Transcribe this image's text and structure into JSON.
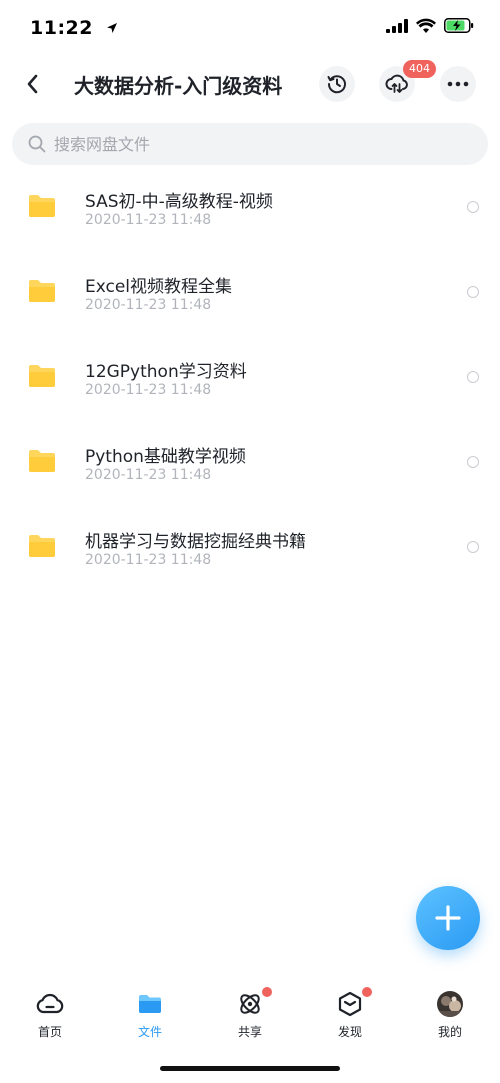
{
  "status": {
    "time": "11:22"
  },
  "header": {
    "title": "大数据分析-入门级资料",
    "transfer_badge": "404"
  },
  "search": {
    "placeholder": "搜索网盘文件"
  },
  "files": [
    {
      "name": "SAS初-中-高级教程-视频",
      "date": "2020-11-23 11:48"
    },
    {
      "name": "Excel视频教程全集",
      "date": "2020-11-23 11:48"
    },
    {
      "name": "12GPython学习资料",
      "date": "2020-11-23 11:48"
    },
    {
      "name": "Python基础教学视频",
      "date": "2020-11-23 11:48"
    },
    {
      "name": "机器学习与数据挖掘经典书籍",
      "date": "2020-11-23 11:48"
    }
  ],
  "tabs": [
    {
      "label": "首页",
      "icon": "cloud-home-icon"
    },
    {
      "label": "文件",
      "icon": "folder-icon",
      "active": true
    },
    {
      "label": "共享",
      "icon": "share-orbit-icon",
      "dot": true
    },
    {
      "label": "发现",
      "icon": "cube-discover-icon",
      "dot": true
    },
    {
      "label": "我的",
      "icon": "avatar"
    }
  ],
  "colors": {
    "accent": "#2b9af3",
    "badge": "#f0625c",
    "folder": "#ffd65c",
    "secondary_text": "#b1b5bb"
  }
}
